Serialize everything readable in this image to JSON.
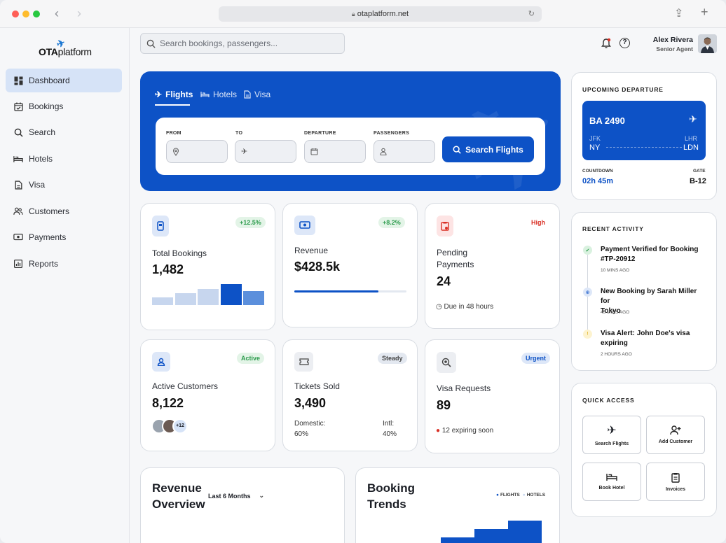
{
  "browser": {
    "url": "otaplatform.net"
  },
  "sidebar": {
    "logo_bold": "OTA",
    "logo_light": "platform",
    "items": [
      {
        "label": "Dashboard",
        "icon": "dashboard-icon",
        "active": true
      },
      {
        "label": "Bookings",
        "icon": "calendar-check-icon"
      },
      {
        "label": "Search",
        "icon": "search-icon"
      },
      {
        "label": "Hotels",
        "icon": "bed-icon"
      },
      {
        "label": "Visa",
        "icon": "document-icon"
      },
      {
        "label": "Customers",
        "icon": "users-icon"
      },
      {
        "label": "Payments",
        "icon": "payment-icon"
      },
      {
        "label": "Reports",
        "icon": "chart-icon"
      }
    ]
  },
  "header": {
    "search_placeholder": "Search bookings, passengers...",
    "user_name": "Alex Rivera",
    "user_role": "Senior Agent",
    "help": "?"
  },
  "hero": {
    "tabs": [
      {
        "label": "Flights",
        "active": true
      },
      {
        "label": "Hotels"
      },
      {
        "label": "Visa"
      }
    ],
    "fields": [
      "FROM",
      "TO",
      "DEPARTURE",
      "PASSENGERS"
    ],
    "button": "Search Flights"
  },
  "stats": [
    {
      "label": "Total Bookings",
      "value": "1,482",
      "badge": "+12.5%",
      "bar_levels": [
        0.35,
        0.55,
        0.75,
        1.0,
        0.65
      ]
    },
    {
      "label": "Revenue",
      "value": "$428.5k",
      "badge": "+8.2%",
      "progress": 0.75
    },
    {
      "label_line1": "Pending",
      "label_line2": "Payments",
      "value": "24",
      "badge": "High",
      "note": "Due in 48 hours"
    },
    {
      "label": "Active Customers",
      "value": "8,122",
      "badge": "Active",
      "extra": "+12"
    },
    {
      "label": "Tickets Sold",
      "value": "3,490",
      "badge": "Steady",
      "dom_label": "Domestic:",
      "dom_value": "60%",
      "intl_label": "Intl:",
      "intl_value": "40%"
    },
    {
      "label": "Visa Requests",
      "value": "89",
      "badge": "Urgent",
      "note": "12 expiring soon"
    }
  ],
  "bottom": {
    "revenue_title_1": "Revenue",
    "revenue_title_2": "Overview",
    "revenue_range": "Last 6 Months",
    "trends_title_1": "Booking",
    "trends_title_2": "Trends",
    "legend_flights": "FLIGHTS",
    "legend_hotels": "HOTELS"
  },
  "departure": {
    "title": "UPCOMING DEPARTURE",
    "flight": "BA 2490",
    "from_code": "JFK",
    "from_city": "NY",
    "to_code": "LHR",
    "to_city": "LDN",
    "countdown_label": "COUNTDOWN",
    "countdown": "02h 45m",
    "gate_label": "GATE",
    "gate": "B-12"
  },
  "activity": {
    "title": "RECENT ACTIVITY",
    "items": [
      {
        "line1": "Payment Verified for Booking",
        "line2": "#TP-20912",
        "time": "10 MINS AGO"
      },
      {
        "line1": "New Booking by Sarah Miller for",
        "line2": "Tokyo",
        "time": "45 MINS AGO"
      },
      {
        "line1": "Visa Alert: John Doe's visa",
        "line2": "expiring",
        "time": "2 HOURS AGO"
      }
    ]
  },
  "quick_access": {
    "title": "QUICK ACCESS",
    "items": [
      "Search Flights",
      "Add Customer",
      "Book Hotel",
      "Invoices"
    ]
  },
  "colors": {
    "primary": "#0d52c6",
    "active_nav": "#d6e3f7",
    "green": "#2e9c4e",
    "red": "#d93025"
  }
}
